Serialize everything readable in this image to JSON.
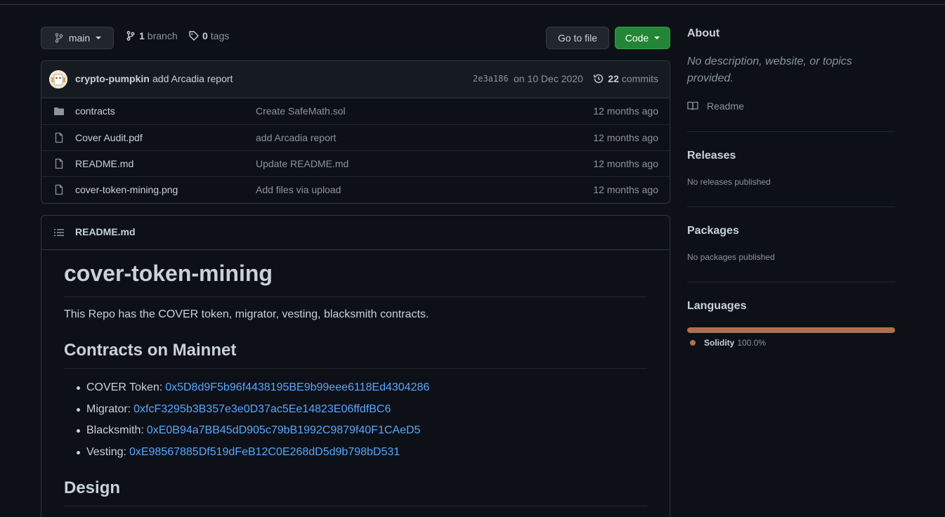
{
  "toolbar": {
    "branch_selector": "main",
    "branch_count": "1",
    "branch_label": "branch",
    "tag_count": "0",
    "tag_label": "tags",
    "go_to_file": "Go to file",
    "code": "Code"
  },
  "commit": {
    "author": "crypto-pumpkin",
    "message": "add Arcadia report",
    "sha": "2e3a186",
    "date": "on 10 Dec 2020",
    "commit_count": "22",
    "commits_label": "commits"
  },
  "files": [
    {
      "icon": "folder-icon",
      "name": "contracts",
      "message": "Create SafeMath.sol",
      "age": "12 months ago"
    },
    {
      "icon": "file-icon",
      "name": "Cover Audit.pdf",
      "message": "add Arcadia report",
      "age": "12 months ago"
    },
    {
      "icon": "file-icon",
      "name": "README.md",
      "message": "Update README.md",
      "age": "12 months ago"
    },
    {
      "icon": "file-icon",
      "name": "cover-token-mining.png",
      "message": "Add files via upload",
      "age": "12 months ago"
    }
  ],
  "readme": {
    "filename": "README.md",
    "title": "cover-token-mining",
    "intro": "This Repo has the COVER token, migrator, vesting, blacksmith contracts.",
    "section1": "Contracts on Mainnet",
    "contracts": [
      {
        "label": "COVER Token:",
        "address": "0x5D8d9F5b96f4438195BE9b99eee6118Ed4304286"
      },
      {
        "label": "Migrator:",
        "address": "0xfcF3295b3B357e3e0D37ac5Ee14823E06ffdfBC6"
      },
      {
        "label": "Blacksmith:",
        "address": "0xE0B94a7BB45dD905c79bB1992C9879f40F1CAeD5"
      },
      {
        "label": "Vesting:",
        "address": "0xE98567885Df519dFeB12C0E268dD5d9b798bD531"
      }
    ],
    "section2": "Design"
  },
  "sidebar": {
    "about_title": "About",
    "about_desc": "No description, website, or topics provided.",
    "readme_link": "Readme",
    "releases_title": "Releases",
    "releases_note": "No releases published",
    "packages_title": "Packages",
    "packages_note": "No packages published",
    "languages_title": "Languages",
    "language_name": "Solidity",
    "language_percent": "100.0%",
    "language_share": 1.0,
    "language_color": "#b0704f"
  },
  "colors": {
    "accent_green": "#238636",
    "link_blue": "#58a6ff"
  }
}
